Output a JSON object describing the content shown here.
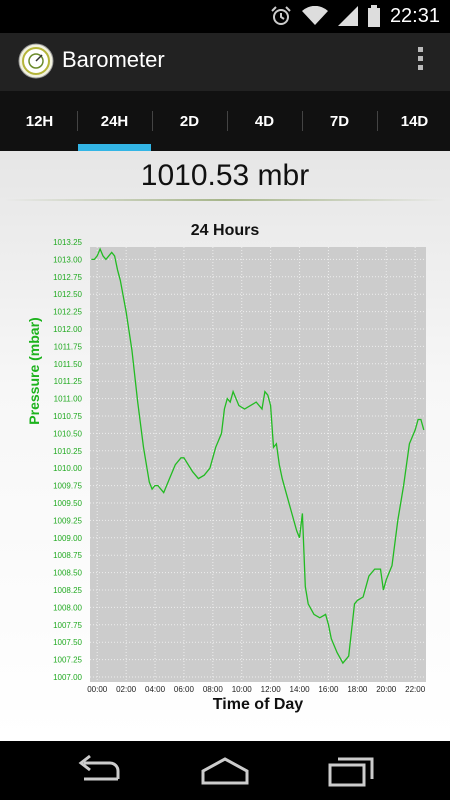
{
  "status_bar": {
    "time": "22:31",
    "icons": [
      "alarm-icon",
      "wifi-icon",
      "signal-icon",
      "battery-icon"
    ]
  },
  "action_bar": {
    "title": "Barometer",
    "icons": [
      "app-logo-icon",
      "overflow-menu-icon"
    ]
  },
  "tabs": [
    {
      "label": "12H",
      "selected": false
    },
    {
      "label": "24H",
      "selected": true
    },
    {
      "label": "2D",
      "selected": false
    },
    {
      "label": "4D",
      "selected": false
    },
    {
      "label": "7D",
      "selected": false
    },
    {
      "label": "14D",
      "selected": false
    }
  ],
  "colors": {
    "accent": "#33b5e5",
    "series": "#22bb22",
    "plot_bg": "#cccccc"
  },
  "reading": "1010.53 mbr",
  "chart_data": {
    "type": "line",
    "title": "24 Hours",
    "xlabel": "Time of Day",
    "ylabel": "Pressure (mbar)",
    "x_ticks": [
      "00:00",
      "02:00",
      "04:00",
      "06:00",
      "08:00",
      "10:00",
      "12:00",
      "14:00",
      "16:00",
      "18:00",
      "20:00",
      "22:00"
    ],
    "y_ticks": [
      "1007.00",
      "1007.25",
      "1007.50",
      "1007.75",
      "1008.00",
      "1008.25",
      "1008.50",
      "1008.75",
      "1009.00",
      "1009.25",
      "1009.50",
      "1009.75",
      "1010.00",
      "1010.25",
      "1010.50",
      "1010.75",
      "1011.00",
      "1011.25",
      "1011.50",
      "1011.75",
      "1012.00",
      "1012.25",
      "1012.50",
      "1012.75",
      "1013.00",
      "1013.25"
    ],
    "ylim": [
      1007.0,
      1013.25
    ],
    "xlim": [
      -0.5,
      22.75
    ],
    "grid": true,
    "series": [
      {
        "x": [
          -0.4,
          -0.2,
          0.0,
          0.2,
          0.4,
          0.6,
          0.8,
          1.0,
          1.2,
          1.4,
          1.6,
          2.0,
          2.4,
          2.8,
          3.2,
          3.6,
          3.8,
          4.0,
          4.2,
          4.6,
          5.0,
          5.4,
          5.8,
          6.0,
          6.6,
          7.0,
          7.4,
          7.8,
          8.2,
          8.6,
          8.8,
          9.0,
          9.2,
          9.4,
          9.8,
          10.2,
          10.6,
          11.0,
          11.4,
          11.6,
          11.8,
          12.0,
          12.2,
          12.4,
          12.6,
          12.8,
          13.0,
          13.4,
          13.8,
          14.0,
          14.2,
          14.4,
          14.6,
          15.0,
          15.4,
          15.8,
          16.0,
          16.2,
          16.6,
          17.0,
          17.4,
          17.8,
          18.0,
          18.4,
          18.8,
          19.2,
          19.6,
          19.8,
          20.0,
          20.4,
          20.8,
          21.2,
          21.6,
          22.0,
          22.2,
          22.4,
          22.6
        ],
        "y": [
          1013.0,
          1013.0,
          1013.05,
          1013.15,
          1013.05,
          1013.0,
          1013.05,
          1013.1,
          1013.05,
          1012.85,
          1012.7,
          1012.25,
          1011.7,
          1010.95,
          1010.3,
          1009.8,
          1009.7,
          1009.75,
          1009.75,
          1009.65,
          1009.85,
          1010.05,
          1010.15,
          1010.15,
          1009.95,
          1009.85,
          1009.9,
          1010.0,
          1010.3,
          1010.5,
          1010.85,
          1011.0,
          1010.95,
          1011.1,
          1010.9,
          1010.85,
          1010.9,
          1010.95,
          1010.85,
          1011.1,
          1011.05,
          1010.9,
          1010.3,
          1010.35,
          1010.05,
          1009.85,
          1009.7,
          1009.4,
          1009.1,
          1009.0,
          1009.35,
          1008.3,
          1008.05,
          1007.9,
          1007.85,
          1007.9,
          1007.75,
          1007.55,
          1007.35,
          1007.2,
          1007.3,
          1008.05,
          1008.1,
          1008.15,
          1008.45,
          1008.55,
          1008.55,
          1008.25,
          1008.4,
          1008.6,
          1009.25,
          1009.75,
          1010.35,
          1010.55,
          1010.7,
          1010.7,
          1010.55
        ]
      }
    ]
  },
  "nav_bar": {
    "buttons": [
      "back-icon",
      "home-icon",
      "recent-apps-icon"
    ]
  }
}
